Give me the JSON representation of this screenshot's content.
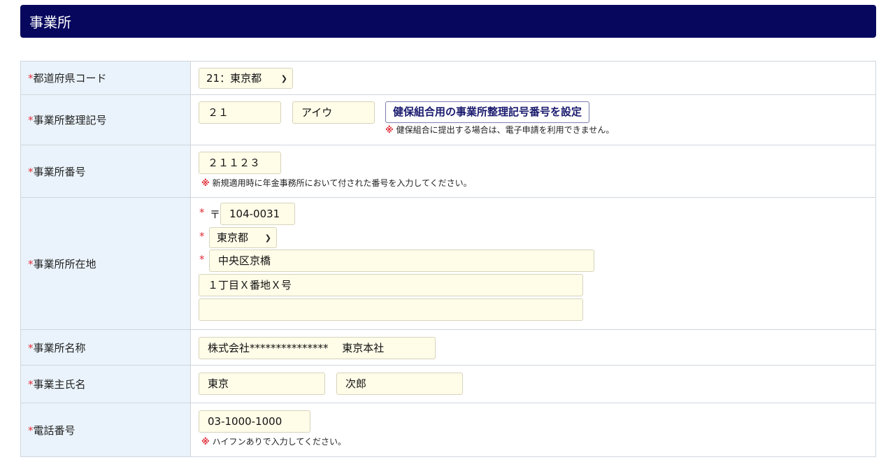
{
  "section": {
    "title": "事業所"
  },
  "required_mark": "*",
  "note_mark": "※",
  "rows": {
    "pref_code": {
      "label": "都道府県コード",
      "value": "21：東京都"
    },
    "office_symbol": {
      "label": "事業所整理記号",
      "value1": "２１",
      "value2": "アイウ",
      "button": "健保組合用の事業所整理記号番号を設定",
      "note": "健保組合に提出する場合は、電子申請を利用できません。"
    },
    "office_number": {
      "label": "事業所番号",
      "value": "２１１２３",
      "note": "新規適用時に年金事務所において付された番号を入力してください。"
    },
    "address": {
      "label": "事業所所在地",
      "postal_mark": "〒",
      "postal": "104-0031",
      "prefecture": "東京都",
      "city": "中央区京橋",
      "street": "１丁目Ｘ番地Ｘ号",
      "building": ""
    },
    "office_name": {
      "label": "事業所名称",
      "value": "株式会社***************　 東京本社"
    },
    "owner_name": {
      "label": "事業主氏名",
      "last": "東京",
      "first": "次郎"
    },
    "phone": {
      "label": "電話番号",
      "value": "03-1000-1000",
      "note": "ハイフンありで入力してください。"
    }
  }
}
